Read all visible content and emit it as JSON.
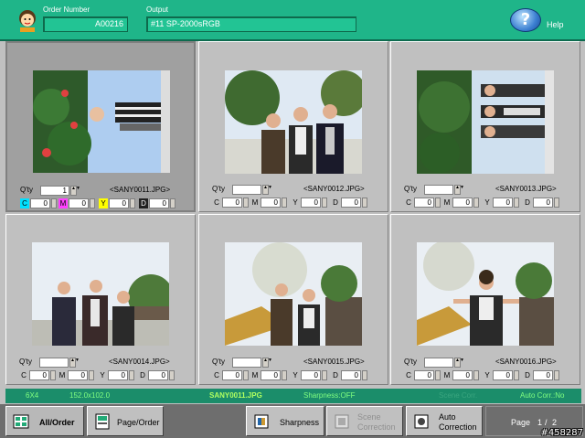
{
  "header": {
    "order_number_label": "Order Number",
    "order_number_value": "A00216",
    "output_label": "Output",
    "output_value": "#11 SP-2000sRGB",
    "help_label": "Help",
    "help_glyph": "?"
  },
  "cells": [
    {
      "qty_label": "Q'ty",
      "qty": "1",
      "filename": "<SANY0011.JPG>",
      "c": "0",
      "m": "0",
      "y": "0",
      "d": "0",
      "selected": true
    },
    {
      "qty_label": "Q'ty",
      "qty": "",
      "filename": "<SANY0012.JPG>",
      "c": "0",
      "m": "0",
      "y": "0",
      "d": "0",
      "selected": false
    },
    {
      "qty_label": "Q'ty",
      "qty": "",
      "filename": "<SANY0013.JPG>",
      "c": "0",
      "m": "0",
      "y": "0",
      "d": "0",
      "selected": false
    },
    {
      "qty_label": "Q'ty",
      "qty": "",
      "filename": "<SANY0014.JPG>",
      "c": "0",
      "m": "0",
      "y": "0",
      "d": "0",
      "selected": false
    },
    {
      "qty_label": "Q'ty",
      "qty": "",
      "filename": "<SANY0015.JPG>",
      "c": "0",
      "m": "0",
      "y": "0",
      "d": "0",
      "selected": false
    },
    {
      "qty_label": "Q'ty",
      "qty": "",
      "filename": "<SANY0016.JPG>",
      "c": "0",
      "m": "0",
      "y": "0",
      "d": "0",
      "selected": false
    }
  ],
  "channel_labels": {
    "c": "C",
    "m": "M",
    "y": "Y",
    "d": "D"
  },
  "status": {
    "size": "6X4",
    "dims": "152.0x102.0",
    "file": "SANY0011.JPG",
    "sharpness": "Sharpness:OFF",
    "scene": "Scene Corr.",
    "auto": "Auto Corr.:No"
  },
  "toolbar": {
    "all_order": "All/Order",
    "page_order": "Page/Order",
    "sharpness": "Sharpness",
    "scene_correction_1": "Scene",
    "scene_correction_2": "Correction",
    "auto_correction_1": "Auto",
    "auto_correction_2": "Correction",
    "page_label": "Page",
    "page_current": "1",
    "page_sep": "/",
    "page_total": "2"
  },
  "watermark": "#458287",
  "colors": {
    "header": "#1fb589",
    "status_bar": "#1b8d6a",
    "status_text": "#80ff80",
    "cyan": "#00e0ff",
    "magenta": "#ff40ff",
    "yellow": "#ffff00"
  }
}
